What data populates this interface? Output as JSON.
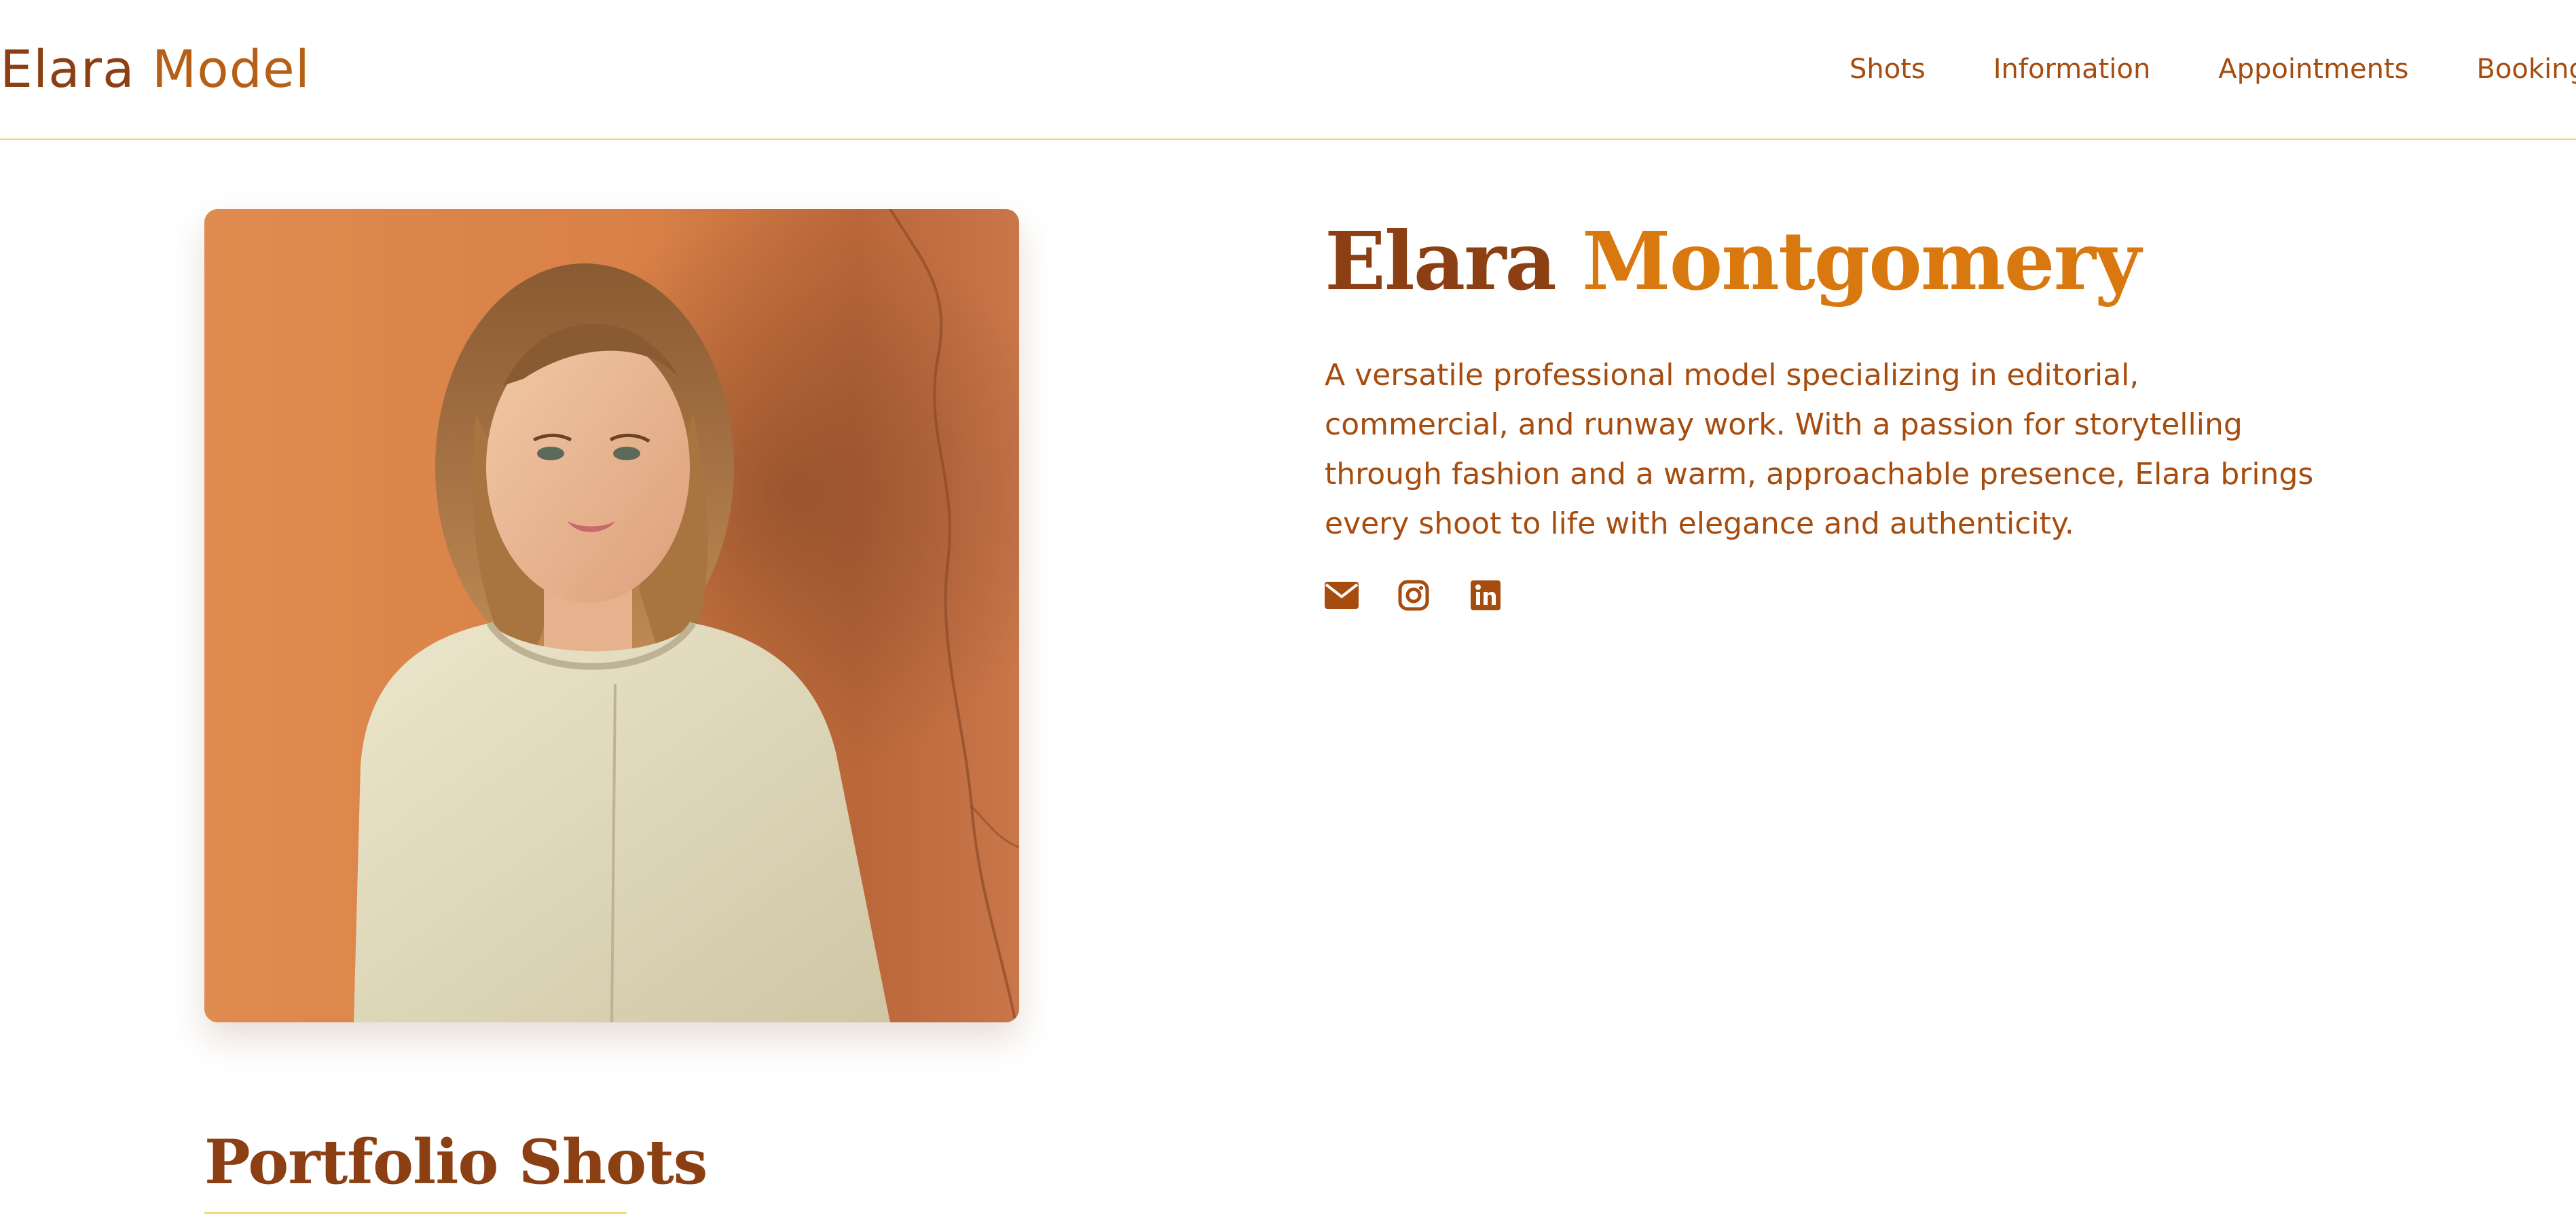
{
  "header": {
    "logo_first": "Elara",
    "logo_second": "Model",
    "nav": [
      "Shots",
      "Information",
      "Appointments",
      "Booking"
    ]
  },
  "profile": {
    "first_name": "Elara",
    "last_name": "Montgomery",
    "bio": "A versatile professional model specializing in editorial, commercial, and runway work. With a passion for storytelling through fashion and a warm, approachable presence, Elara brings every shoot to life with elegance and authenticity.",
    "socials": [
      "envelope-icon",
      "instagram-icon",
      "linkedin-icon"
    ]
  },
  "portfolio": {
    "title": "Portfolio Shots"
  },
  "colors": {
    "brown": "#8b3f12",
    "orange": "#d9780f",
    "text": "#a64c0f",
    "accent_line": "#f5d778"
  }
}
